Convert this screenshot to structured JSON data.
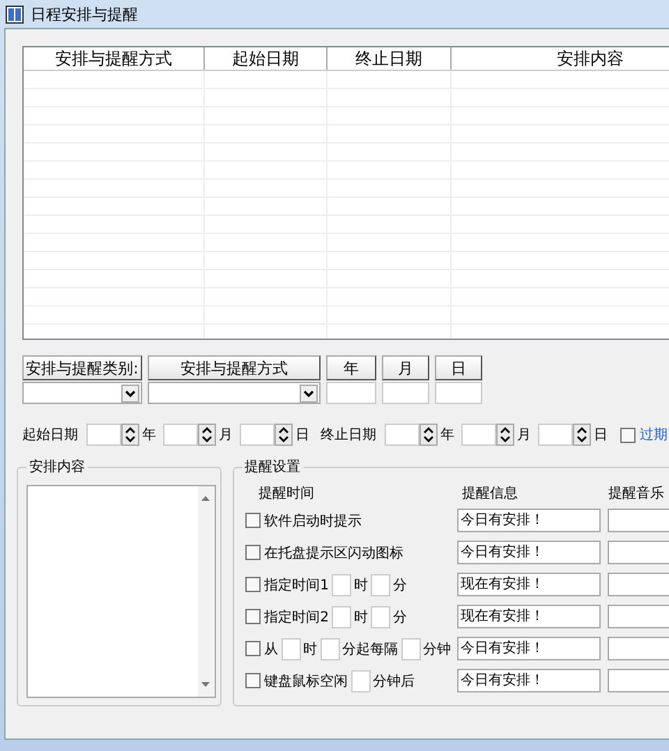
{
  "window": {
    "title": "日程安排与提醒"
  },
  "table": {
    "columns": [
      "安排与提醒方式",
      "起始日期",
      "终止日期",
      "安排内容"
    ]
  },
  "filter_fields": [
    {
      "header": "安排与提醒类别:",
      "kind": "combo"
    },
    {
      "header": "安排与提醒方式",
      "kind": "combo"
    },
    {
      "header": "年",
      "kind": "text"
    },
    {
      "header": "月",
      "kind": "text"
    },
    {
      "header": "日",
      "kind": "text"
    }
  ],
  "start_date": {
    "label": "起始日期",
    "units": [
      "年",
      "月",
      "日"
    ]
  },
  "end_date": {
    "label": "终止日期",
    "units": [
      "年",
      "月",
      "日"
    ]
  },
  "expired": {
    "label": "过期",
    "checked": false
  },
  "content_group": {
    "title": "安排内容"
  },
  "reminder_group": {
    "title": "提醒设置",
    "columns": [
      "提醒时间",
      "提醒信息",
      "提醒音乐"
    ],
    "rows": [
      {
        "label": "软件启动时提示",
        "checked": false,
        "units": [],
        "message": "今日有安排！"
      },
      {
        "label": "在托盘提示区闪动图标",
        "checked": false,
        "units": [],
        "message": "今日有安排！"
      },
      {
        "label": "指定时间1",
        "checked": false,
        "units": [
          "时",
          "分"
        ],
        "message": "现在有安排！"
      },
      {
        "label": "指定时间2",
        "checked": false,
        "units": [
          "时",
          "分"
        ],
        "message": "现在有安排！"
      },
      {
        "label": "从",
        "checked": false,
        "units": [
          "时",
          "分起每隔",
          "分钟"
        ],
        "message": "今日有安排！"
      },
      {
        "label": "键盘鼠标空闲",
        "checked": false,
        "units": [
          "分钟后"
        ],
        "message": "今日有安排！"
      }
    ]
  }
}
